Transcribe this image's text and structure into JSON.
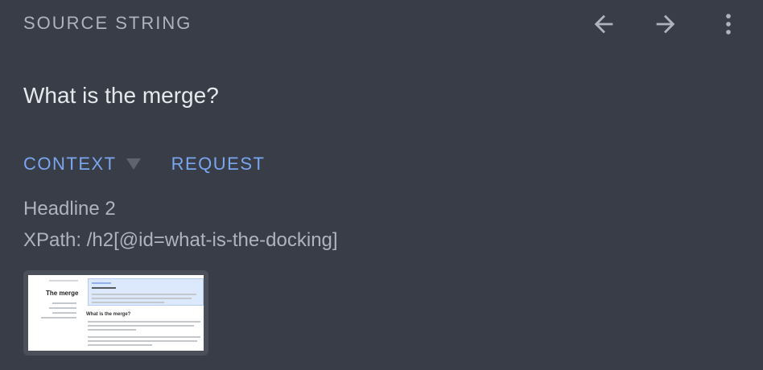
{
  "header": {
    "title": "SOURCE STRING"
  },
  "toolbar": {
    "prev_icon": "arrow-left-icon",
    "next_icon": "arrow-right-icon",
    "more_icon": "more-vert-icon"
  },
  "source": {
    "text": "What is the merge?"
  },
  "tabs": [
    {
      "label": "CONTEXT",
      "has_dropdown": true
    },
    {
      "label": "REQUEST",
      "has_dropdown": false
    }
  ],
  "context": {
    "type": "Headline 2",
    "xpath": "XPath: /h2[@id=what-is-the-docking]"
  },
  "thumbnail": {
    "title": "The merge",
    "subheading": "What is the merge?"
  },
  "colors": {
    "background": "#393d47",
    "header_text": "#aeb3bd",
    "primary_text": "#e6e8ec",
    "accent": "#7aa6f0",
    "icon": "#aeb3bd"
  }
}
